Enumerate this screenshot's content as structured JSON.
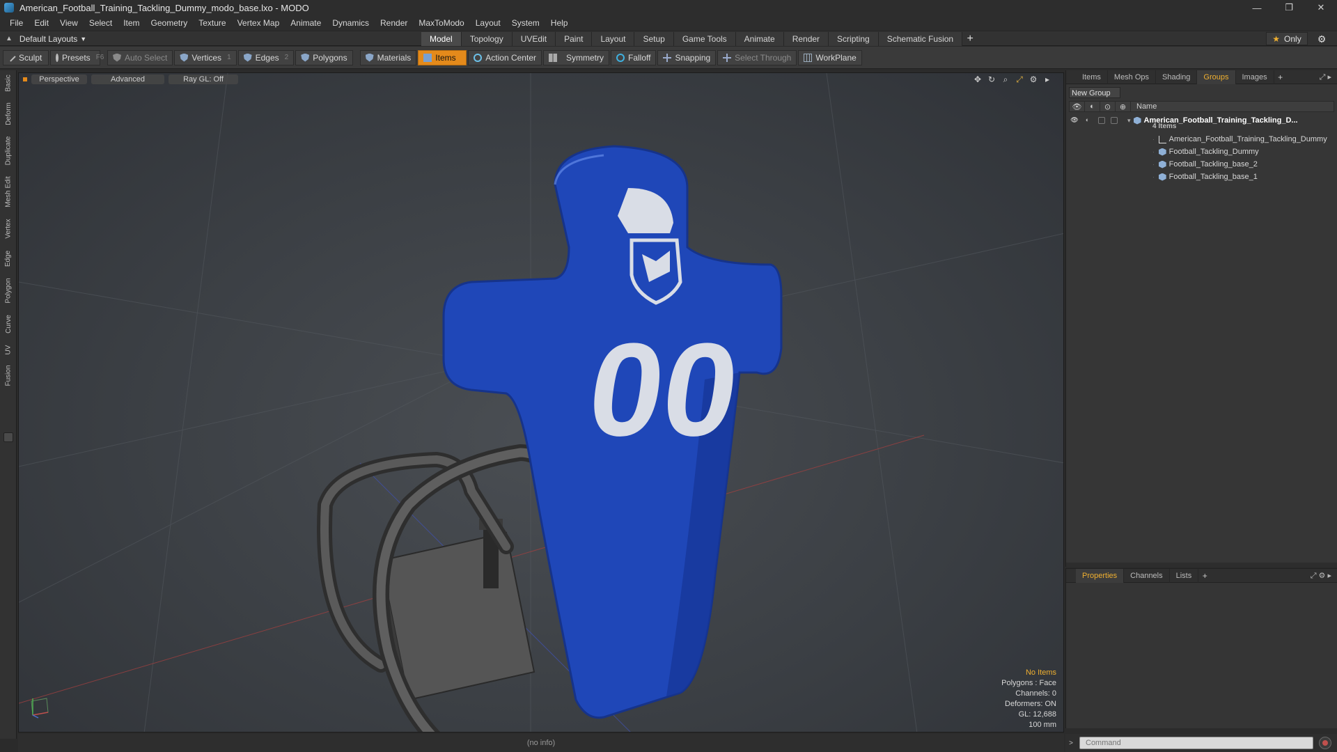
{
  "window": {
    "title": "American_Football_Training_Tackling_Dummy_modo_base.lxo - MODO",
    "controls": [
      "—",
      "❐",
      "✕"
    ]
  },
  "menu": [
    "File",
    "Edit",
    "View",
    "Select",
    "Item",
    "Geometry",
    "Texture",
    "Vertex Map",
    "Animate",
    "Dynamics",
    "Render",
    "MaxToModo",
    "Layout",
    "System",
    "Help"
  ],
  "layout_bar": {
    "layout_name": "Default Layouts",
    "tabs": [
      "Model",
      "Topology",
      "UVEdit",
      "Paint",
      "Layout",
      "Setup",
      "Game Tools",
      "Animate",
      "Render",
      "Scripting",
      "Schematic Fusion"
    ],
    "active_tab": "Model",
    "add": "+",
    "only_label": "Only"
  },
  "toolbar": {
    "sculpt": "Sculpt",
    "presets": "Presets",
    "presets_hotkey": "F6",
    "auto_select": "Auto Select",
    "vertices": "Vertices",
    "vertices_count": "1",
    "edges": "Edges",
    "edges_count": "2",
    "polygons": "Polygons",
    "materials": "Materials",
    "items": "Items",
    "action_center": "Action Center",
    "symmetry": "Symmetry",
    "falloff": "Falloff",
    "snapping": "Snapping",
    "select_through": "Select Through",
    "workplane": "WorkPlane"
  },
  "left_tabs": [
    "Basic",
    "Deform",
    "Duplicate",
    "Mesh Edit",
    "Vertex",
    "Edge",
    "Polygon",
    "Curve",
    "UV",
    "Fusion"
  ],
  "viewport": {
    "view_mode": "Perspective",
    "shading": "Advanced",
    "raygl": "Ray GL: Off",
    "jersey_number": "00",
    "stats": {
      "selection": "No Items",
      "polygons": "Polygons : Face",
      "channels": "Channels: 0",
      "deformers": "Deformers: ON",
      "gl": "GL: 12,688",
      "units": "100 mm"
    }
  },
  "groups_panel": {
    "tabs": [
      "Items",
      "Mesh Ops",
      "Shading",
      "Groups",
      "Images"
    ],
    "active_tab": "Groups",
    "add": "+",
    "new_group": "New Group",
    "name_header": "Name",
    "group_name": "American_Football_Training_Tackling_D...",
    "group_count": "4 Items",
    "children": [
      "American_Football_Training_Tackling_Dummy",
      "Football_Tackling_Dummy",
      "Football_Tackling_base_2",
      "Football_Tackling_base_1"
    ]
  },
  "properties_panel": {
    "tabs": [
      "Properties",
      "Channels",
      "Lists"
    ],
    "active_tab": "Properties",
    "add": "+"
  },
  "command": {
    "placeholder": "Command"
  },
  "status": {
    "info": "(no info)"
  },
  "colors": {
    "accent": "#e48a1b",
    "dummy_blue": "#1f47b8",
    "number_white": "#d9dde6",
    "frame_grey": "#3c3c3c"
  }
}
